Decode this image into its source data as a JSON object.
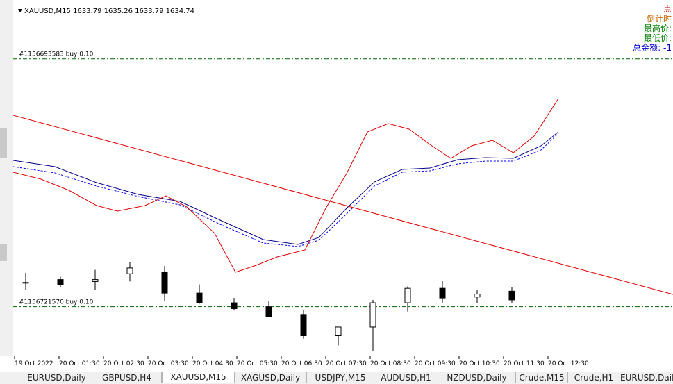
{
  "chart_data": {
    "type": "candlestick",
    "symbol_header": "XAUUSD,M15  1633.79 1635.26 1633.79 1634.74",
    "ylim": [
      1629,
      1665
    ],
    "candles": [
      {
        "o": 1636.4,
        "h": 1637.4,
        "l": 1635.6,
        "c": 1636.4
      },
      {
        "o": 1636.7,
        "h": 1637.0,
        "l": 1635.9,
        "c": 1636.2
      },
      {
        "o": 1636.5,
        "h": 1637.7,
        "l": 1635.6,
        "c": 1636.7
      },
      {
        "o": 1637.3,
        "h": 1638.5,
        "l": 1636.5,
        "c": 1637.9
      },
      {
        "o": 1637.5,
        "h": 1638.1,
        "l": 1634.5,
        "c": 1635.3
      },
      {
        "o": 1635.3,
        "h": 1636.2,
        "l": 1634.2,
        "c": 1634.3
      },
      {
        "o": 1634.3,
        "h": 1634.8,
        "l": 1633.5,
        "c": 1633.7
      },
      {
        "o": 1633.9,
        "h": 1634.5,
        "l": 1632.8,
        "c": 1632.9
      },
      {
        "o": 1633.1,
        "h": 1633.6,
        "l": 1630.6,
        "c": 1630.9
      },
      {
        "o": 1630.9,
        "h": 1631.8,
        "l": 1629.9,
        "c": 1631.8
      },
      {
        "o": 1631.8,
        "h": 1634.6,
        "l": 1629.3,
        "c": 1634.3
      },
      {
        "o": 1634.3,
        "h": 1636.0,
        "l": 1633.4,
        "c": 1635.8
      },
      {
        "o": 1635.8,
        "h": 1636.6,
        "l": 1634.3,
        "c": 1634.8
      },
      {
        "o": 1634.9,
        "h": 1635.6,
        "l": 1634.3,
        "c": 1635.2
      },
      {
        "o": 1635.5,
        "h": 1635.9,
        "l": 1634.3,
        "c": 1634.6
      }
    ],
    "x_ticks": [
      "19 Oct 2022",
      "20 Oct 01:30",
      "20 Oct 02:30",
      "20 Oct 03:30",
      "20 Oct 04:30",
      "20 Oct 05:30",
      "20 Oct 06:30",
      "20 Oct 07:30",
      "20 Oct 08:30",
      "20 Oct 09:30",
      "20 Oct 10:30",
      "20 Oct 11:30",
      "20 Oct 12:30"
    ],
    "order_lines": [
      {
        "label": "#1156693583 buy 0.10",
        "price": 1659.5
      },
      {
        "label": "#1156721570 buy 0.10",
        "price": 1633.9
      }
    ],
    "trendline": {
      "from": [
        0,
        1650.0
      ],
      "to": [
        59,
        1614.0
      ]
    },
    "info_panel": [
      {
        "text": "点",
        "color": "#cc0000"
      },
      {
        "text": "倒计时",
        "color": "#cc6600"
      },
      {
        "text": "最高价:",
        "color": "#008000"
      },
      {
        "text": "最低价:",
        "color": "#008000"
      },
      {
        "text": "总金额: -1",
        "color": "#0000cc"
      }
    ]
  },
  "tabs": [
    {
      "label": "EURUSD,Daily",
      "active": false
    },
    {
      "label": "GBPUSD,H4",
      "active": false
    },
    {
      "label": "XAUUSD,M15",
      "active": true
    },
    {
      "label": "XAGUSD,Daily",
      "active": false
    },
    {
      "label": "USDJPY,M15",
      "active": false
    },
    {
      "label": "AUDUSD,H1",
      "active": false
    },
    {
      "label": "NZDUSD,Daily",
      "active": false
    },
    {
      "label": "Crude,M15",
      "active": false
    },
    {
      "label": "Crude,H1",
      "active": false
    },
    {
      "label": "EURUSD,Daily",
      "active": false
    }
  ]
}
